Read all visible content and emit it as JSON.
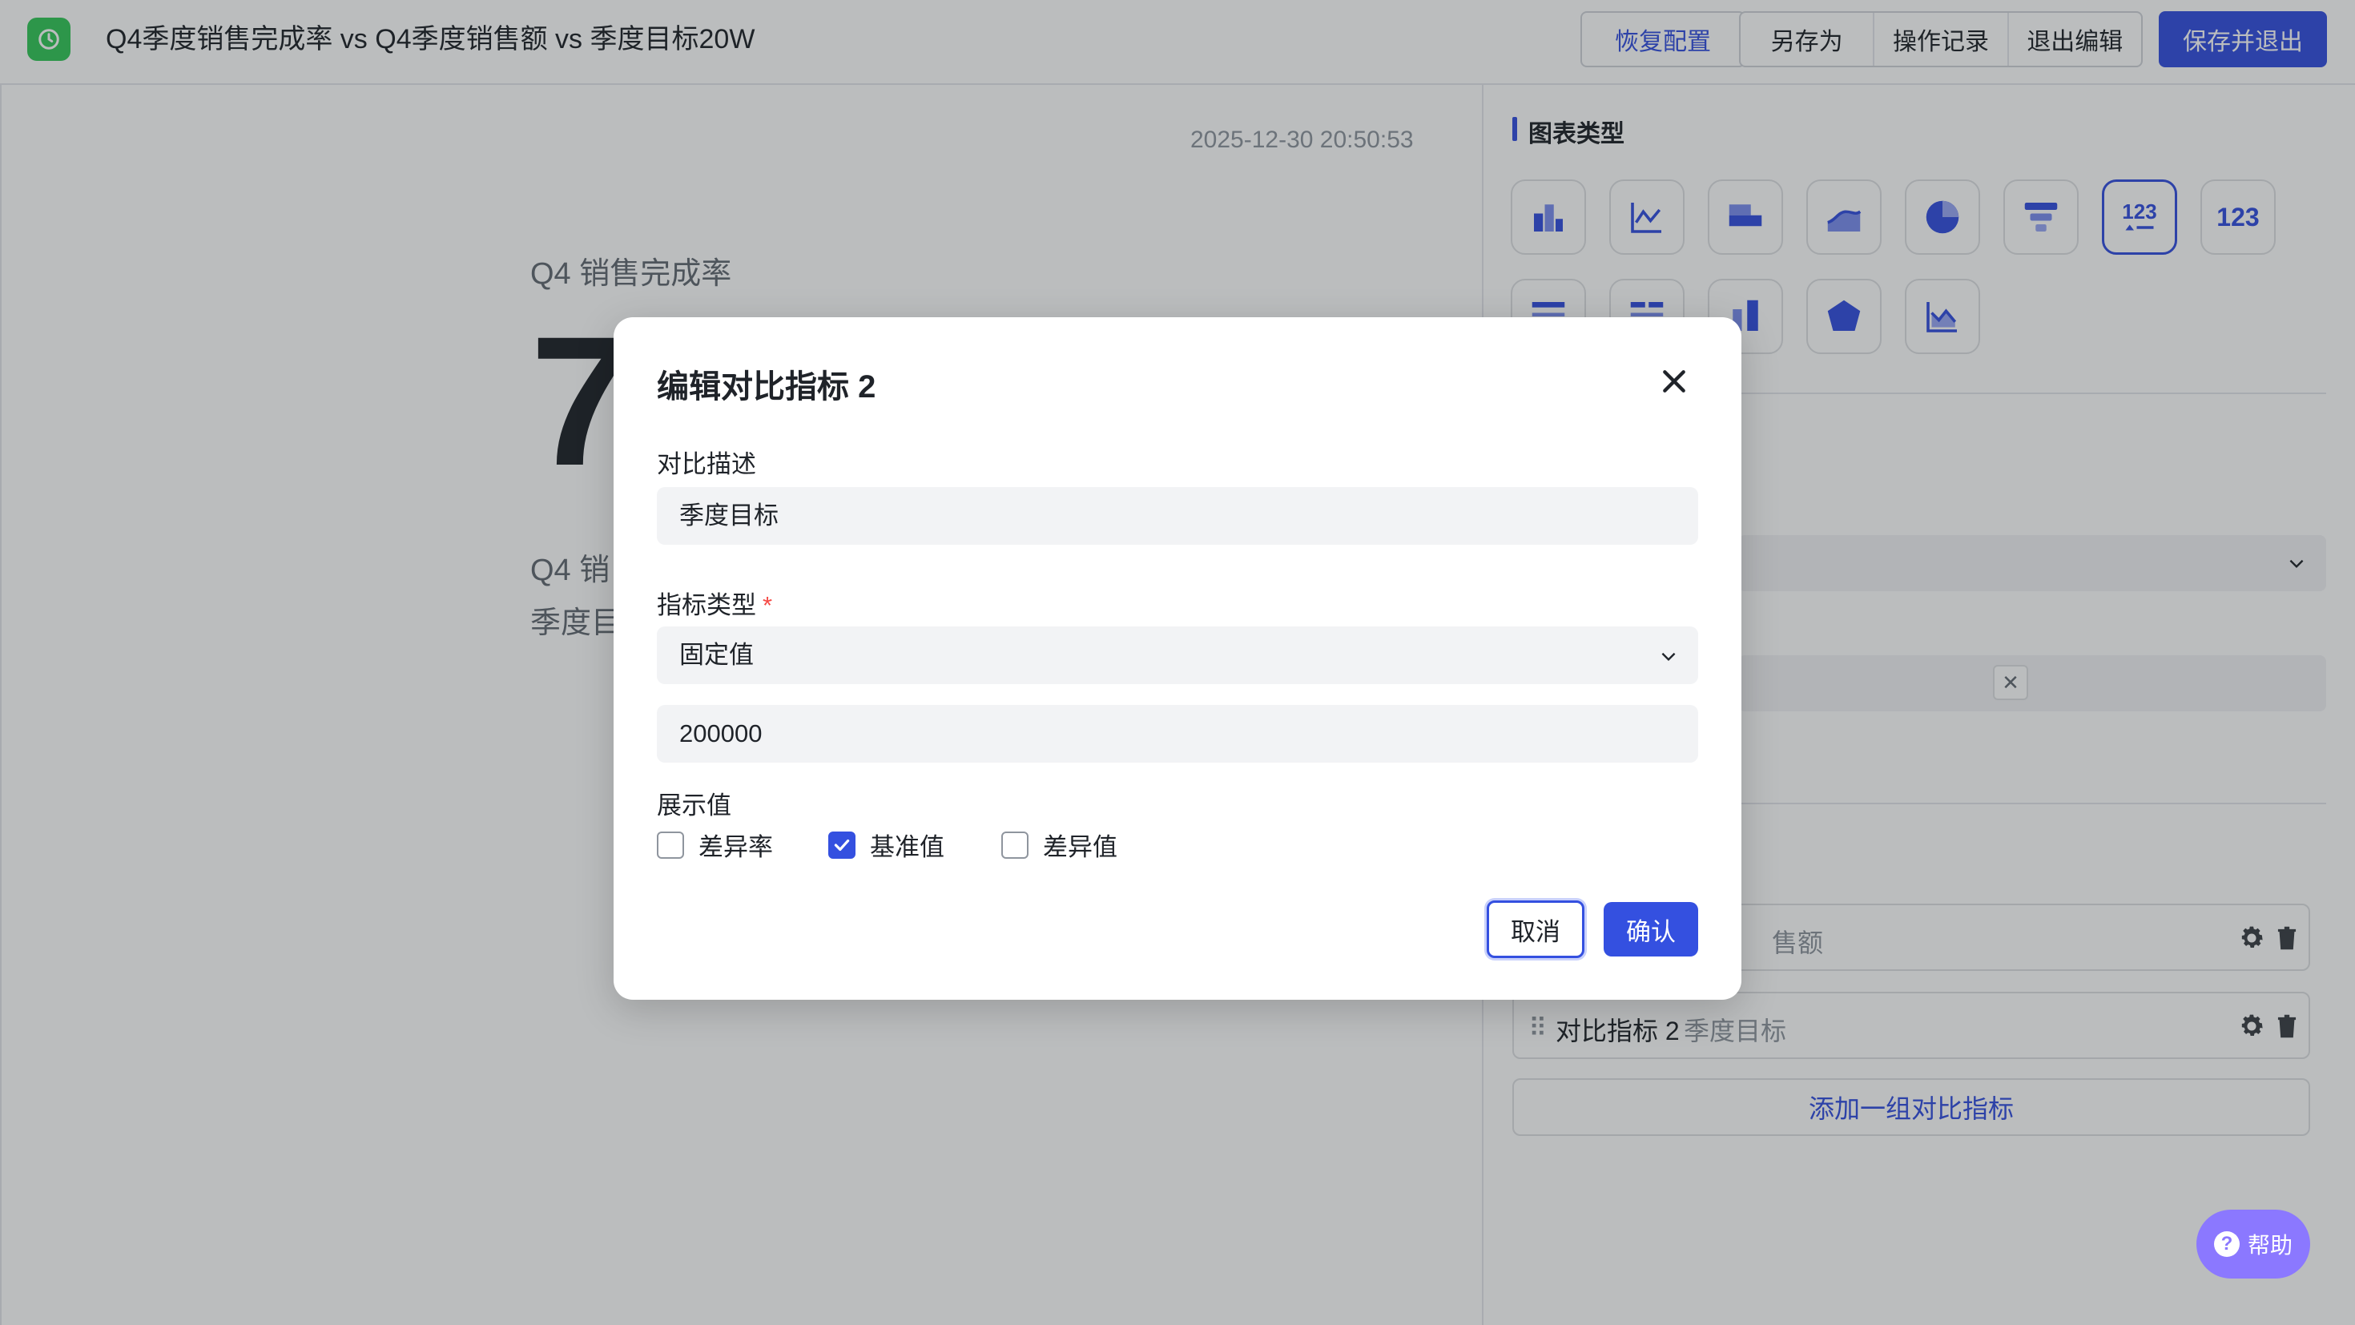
{
  "header": {
    "title": "Q4季度销售完成率 vs Q4季度销售额 vs 季度目标20W",
    "restore_label": "恢复配置",
    "save_as_label": "另存为",
    "history_label": "操作记录",
    "exit_edit_label": "退出编辑",
    "save_exit_label": "保存并退出"
  },
  "canvas": {
    "timestamp": "2025-12-30 20:50:53",
    "card_title": "Q4 销售完成率",
    "big_number": "7",
    "sub_line_1": "Q4 销",
    "sub_line_2": "季度目"
  },
  "panel": {
    "chart_type_title": "图表类型",
    "chart_types": [
      "bar-chart-icon",
      "line-chart-icon",
      "horizontal-bar-icon",
      "area-chart-icon",
      "pie-chart-icon",
      "funnel-chart-icon",
      "kpi-card-icon",
      "number-card-icon",
      "table-icon",
      "list-table-icon",
      "stacked-bar-icon",
      "radar-chart-icon",
      "combo-chart-icon"
    ],
    "kpi_active_label": "123",
    "number_label": "123",
    "metrics": [
      {
        "name": "",
        "desc": "售额"
      },
      {
        "name": "对比指标 2",
        "desc": "季度目标"
      }
    ],
    "add_button": "添加一组对比指标",
    "help_label": "帮助",
    "help_glyph": "?"
  },
  "modal": {
    "title": "编辑对比指标 2",
    "desc_label": "对比描述",
    "desc_value": "季度目标",
    "type_label": "指标类型",
    "required_mark": "*",
    "type_value": "固定值",
    "fixed_value": "200000",
    "display_label": "展示值",
    "options": [
      {
        "label": "差异率",
        "checked": false
      },
      {
        "label": "基准值",
        "checked": true
      },
      {
        "label": "差异值",
        "checked": false
      }
    ],
    "cancel_label": "取消",
    "confirm_label": "确认"
  },
  "colors": {
    "accent": "#3450e0",
    "logo": "#34c759",
    "help": "#8b78ff",
    "required": "#f54a45"
  }
}
